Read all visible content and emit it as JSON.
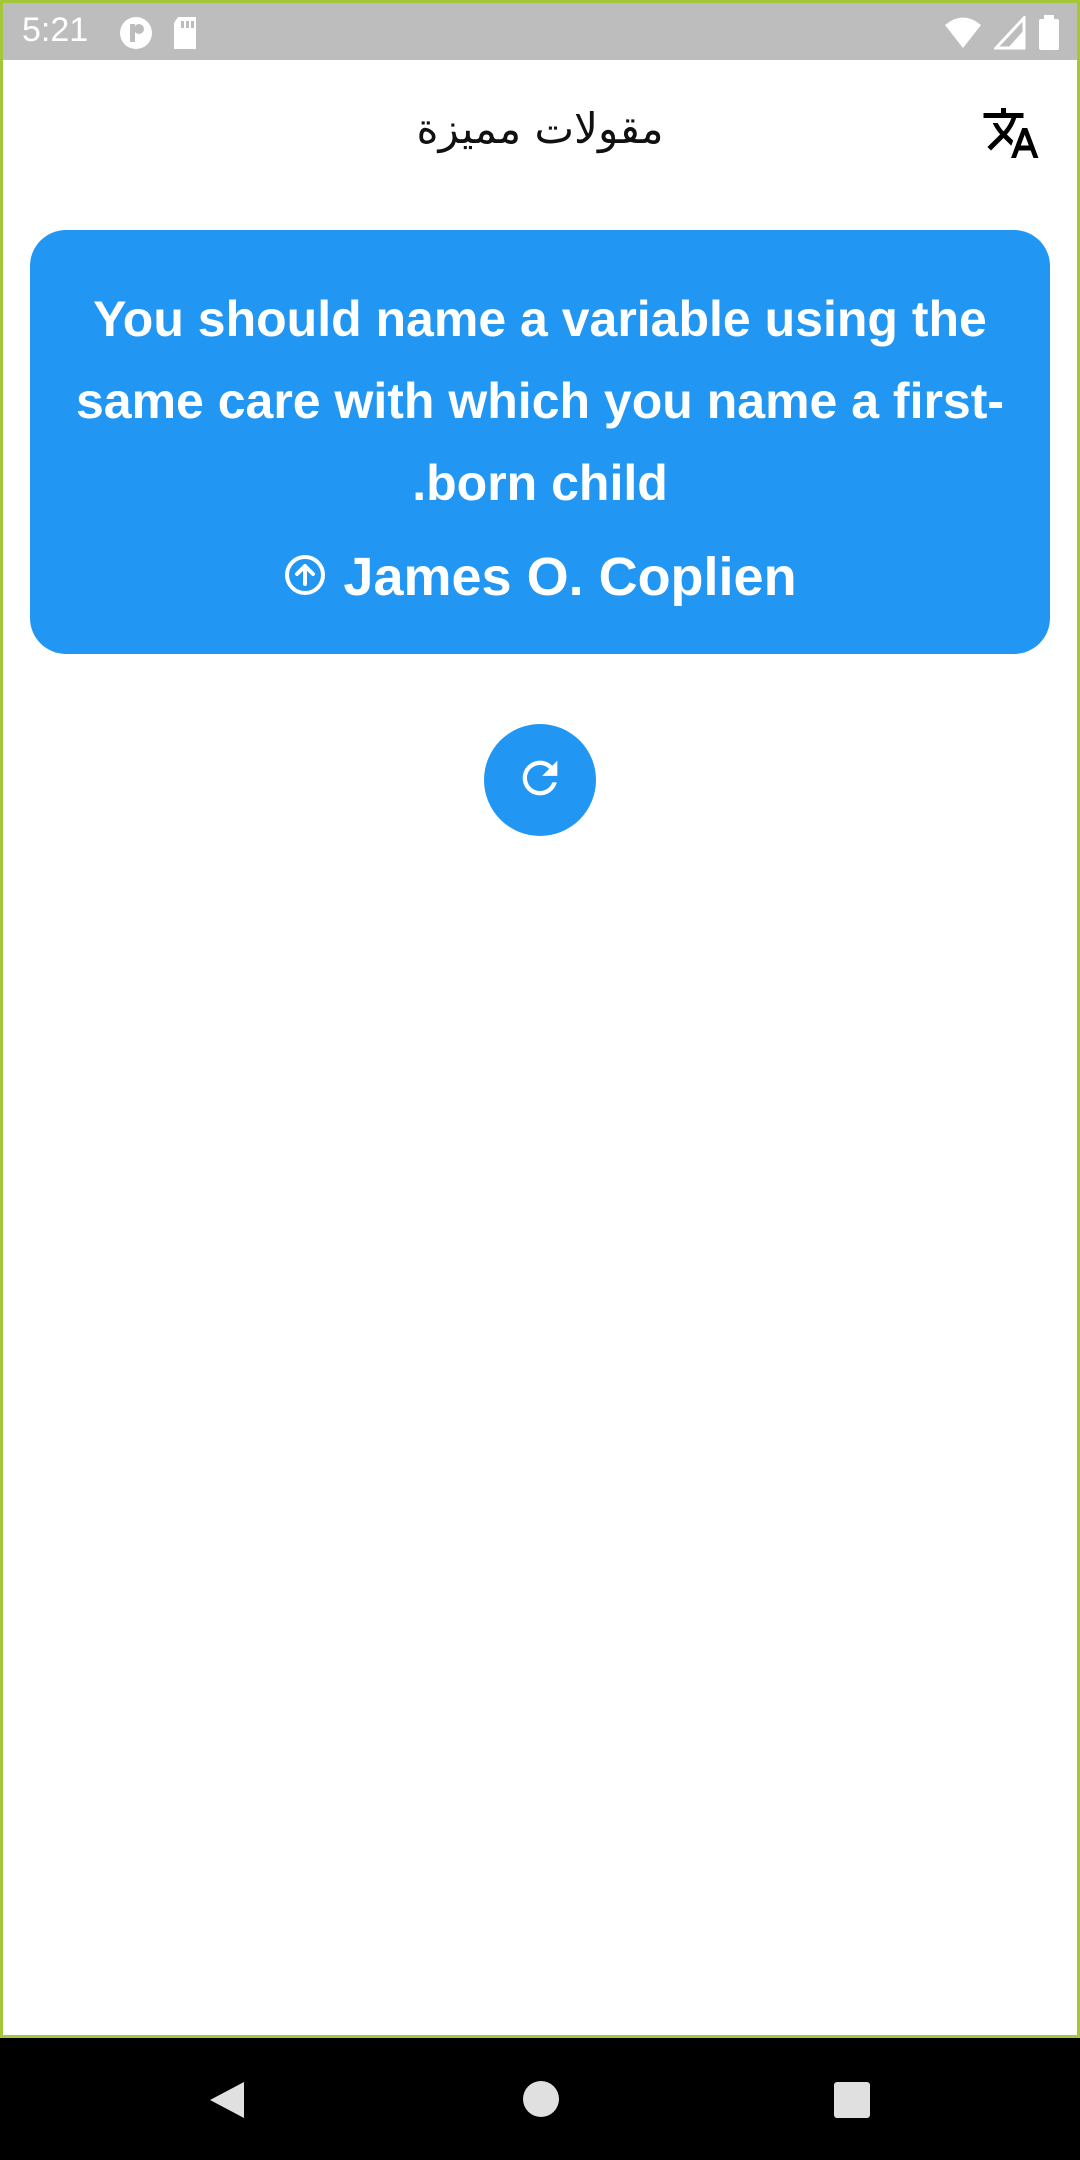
{
  "status_bar": {
    "time": "5:21",
    "left_icons": [
      "notification-app-icon",
      "sd-card-icon"
    ],
    "right_icons": [
      "wifi-icon",
      "cell-signal-icon",
      "battery-icon"
    ]
  },
  "app_bar": {
    "title": "مقولات مميزة",
    "translate_icon": "translate-icon"
  },
  "quote": {
    "text": "You should name a variable using the same care with which you name a first-born child.",
    "author": "James O. Coplien",
    "author_icon": "arrow-up-circle-icon"
  },
  "actions": {
    "refresh_icon": "refresh-icon"
  },
  "nav_bar": {
    "buttons": [
      "back-icon",
      "home-icon",
      "recents-icon"
    ]
  },
  "colors": {
    "accent": "#2196f3",
    "status_bar": "#bdbdbd",
    "frame": "#a4c639"
  }
}
